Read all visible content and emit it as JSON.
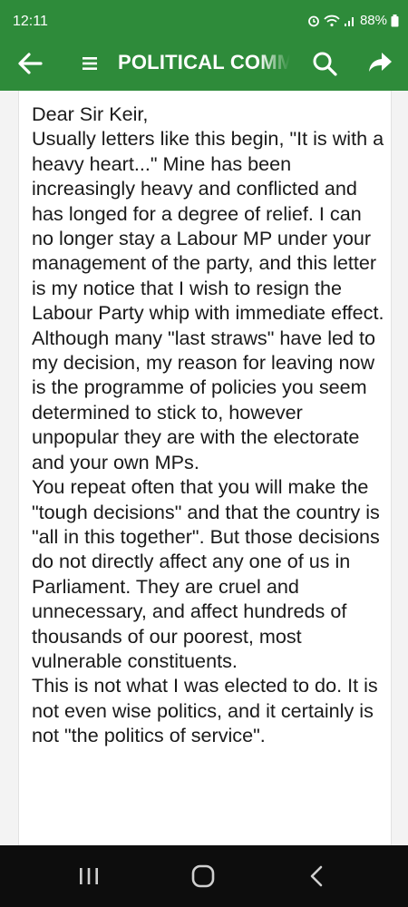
{
  "status_bar": {
    "time": "12:11",
    "battery": "88%",
    "icons": [
      "alarm-icon",
      "wifi-icon",
      "signal-icon",
      "battery-icon"
    ]
  },
  "app_bar": {
    "title": "POLITICAL COMMENTARY",
    "background": "#2e8b3a",
    "icons": [
      "back-arrow-icon",
      "menu-icon",
      "search-icon",
      "share-icon"
    ]
  },
  "letter": {
    "paragraphs": [
      "Dear Sir Keir,",
      "Usually letters like this begin, \"It is with a heavy heart...\" Mine has been increasingly heavy and conflicted and has longed for a degree of relief. I can no longer stay a Labour MP under your management of the party, and this letter is my notice that I wish to resign the Labour Party whip with immediate effect.",
      "Although many \"last straws\" have led to my decision, my reason for leaving now is the programme of policies you seem determined to stick to, however unpopular they are with the electorate and your own MPs.",
      "You repeat often that you will make the \"tough decisions\" and that the country is \"all in this together\". But those decisions do not directly affect any one of us in Parliament. They are cruel and unnecessary, and affect hundreds of thousands of our poorest, most vulnerable constituents.",
      "This is not what I was elected to do. It is not even wise politics, and it certainly is not \"the politics of service\"."
    ]
  },
  "nav_bar": {
    "icons": [
      "recent-apps-icon",
      "home-icon",
      "back-icon"
    ]
  }
}
